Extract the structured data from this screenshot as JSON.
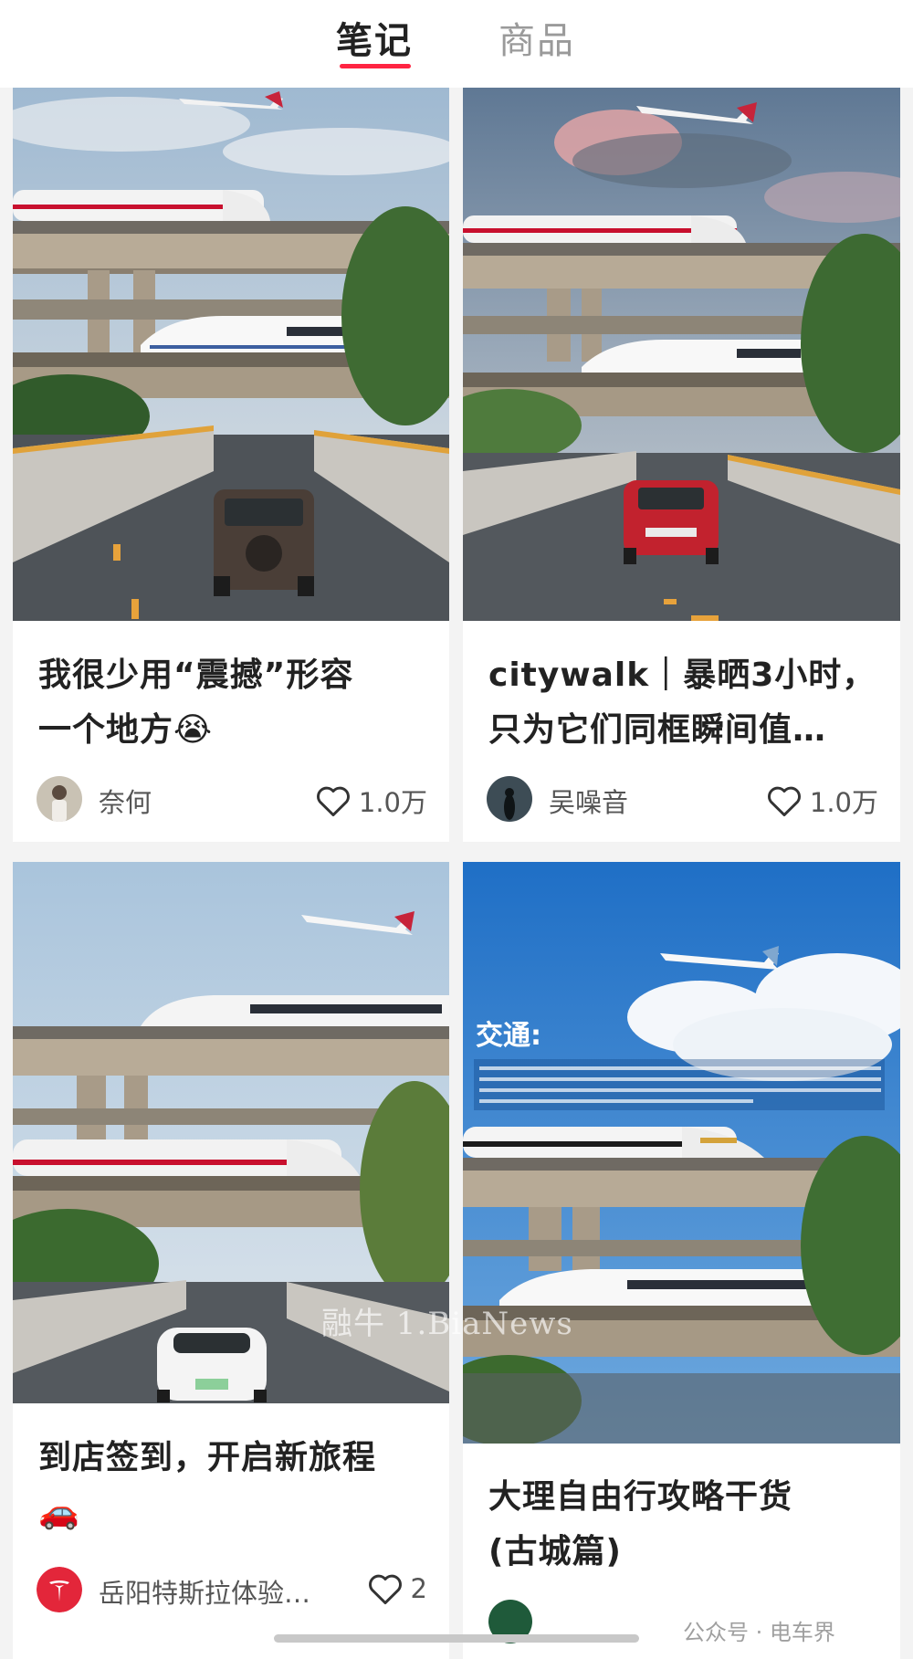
{
  "tabs": {
    "notes": "笔记",
    "goods": "商品",
    "active": "notes",
    "accent_color": "#ff2442"
  },
  "cards": [
    {
      "title_lines": [
        "我很少用“震撼”形容",
        "一个地方😭"
      ],
      "author": "奈何",
      "likes": "1.0万",
      "image": "train-and-plane-over-highway-suv"
    },
    {
      "title_lines": [
        "citywalk｜暴晒3小时，",
        "只为它们同框瞬间值…"
      ],
      "author": "吴噪音",
      "likes": "1.0万",
      "image": "train-and-plane-over-highway-red-car"
    },
    {
      "title_lines": [
        "到店签到，开启新旅程",
        "🚗"
      ],
      "author": "岳阳特斯拉体验…",
      "likes": "2",
      "image": "trains-over-road-white-tesla"
    },
    {
      "title_lines": [
        "大理自由行攻略干货",
        "(古城篇)"
      ],
      "image": "transport-guide-train-plane",
      "overlay_heading": "交通:",
      "overlay_text": "大理的交通便利程度比不上昆明，没有地铁，但是租车，包车，滴滴打车都非常方便，打车不用等，骑行和小电驴也是很好的选择，吹吹洱海的风，就是一个好的体验，自驾小电驴也不错…总结：大理交通推荐：租车》小电驴》包车》打车》自行车"
    }
  ],
  "watermarks": {
    "center": "融牛 1.BiaNews",
    "corner": "公众号 · 电车界"
  }
}
